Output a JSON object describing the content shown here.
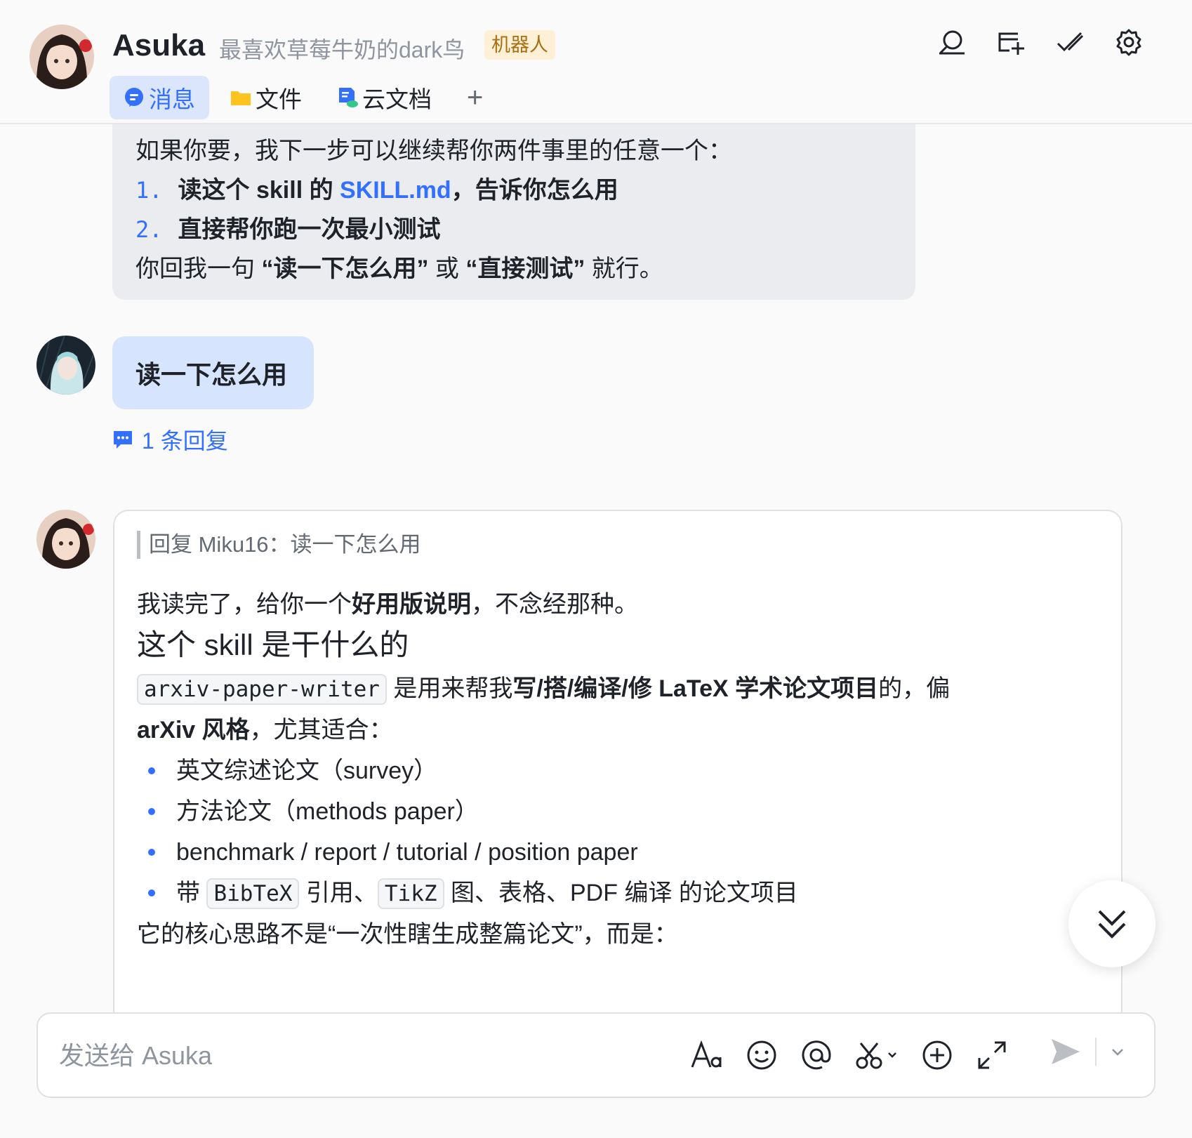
{
  "header": {
    "title": "Asuka",
    "signature": "最喜欢草莓牛奶的dark鸟",
    "tag": "机器人",
    "icons": [
      "search-icon",
      "add-window-icon",
      "checkmark-icon",
      "settings-icon"
    ],
    "tabs": [
      {
        "label": "消息",
        "icon": "message-icon",
        "active": true
      },
      {
        "label": "文件",
        "icon": "folder-icon",
        "active": false
      },
      {
        "label": "云文档",
        "icon": "cloud-doc-icon",
        "active": false
      }
    ],
    "add_tab": "+"
  },
  "messages": {
    "prev": {
      "intro": "如果你要，我下一步可以继续帮你两件事里的任意一个：",
      "item1_num": "1.",
      "item1_a": "读这个 skill 的 ",
      "item1_link": "SKILL.md",
      "item1_b": "，告诉你怎么用",
      "item2_num": "2.",
      "item2": "直接帮你跑一次最小测试",
      "closing_a": "你回我一句 ",
      "closing_b": "“读一下怎么用”",
      "closing_c": " 或 ",
      "closing_d": "“直接测试”",
      "closing_e": " 就行。"
    },
    "user_msg": "读一下怎么用",
    "reply_count": "1 条回复",
    "bot_reply": {
      "quote": "回复 Miku16：读一下怎么用",
      "line1_a": "我读完了，给你一个",
      "line1_b": "好用版说明",
      "line1_c": "，不念经那种。",
      "heading": "这个 skill 是干什么的",
      "code1": "arxiv-paper-writer",
      "para_a": " 是用来帮我",
      "para_b": "写/搭/编译/修 LaTeX 学术论文项目",
      "para_c": "的，偏",
      "para_d": "arXiv 风格",
      "para_e": "，尤其适合：",
      "bullets": [
        "英文综述论文（survey）",
        "方法论文（methods paper）",
        "benchmark / report / tutorial / position paper"
      ],
      "bullet4_a": "带 ",
      "bullet4_code1": "BibTeX",
      "bullet4_b": " 引用、",
      "bullet4_code2": "TikZ",
      "bullet4_c": " 图、表格、PDF 编译 的论文项目",
      "tail": "它的核心思路不是“一次性瞎生成整篇论文”，而是："
    }
  },
  "composer": {
    "placeholder": "发送给 Asuka",
    "tools": [
      "text-format-icon",
      "emoji-icon",
      "mention-icon",
      "screenshot-icon",
      "add-icon",
      "expand-icon"
    ]
  },
  "colors": {
    "accent": "#3370ff",
    "user_bubble": "#d6e4fd",
    "bot_bubble": "#ebecef",
    "tag_bg": "#fdf0d6"
  }
}
